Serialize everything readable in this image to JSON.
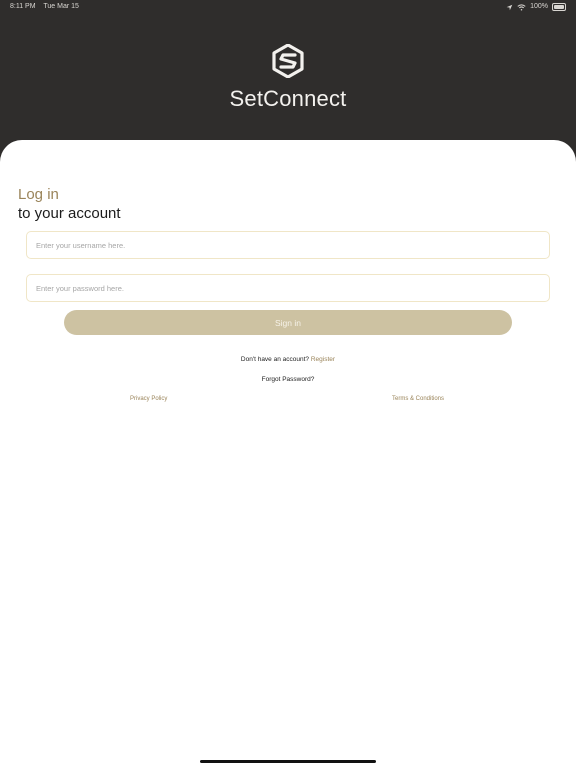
{
  "status_bar": {
    "time": "8:11 PM",
    "date": "Tue Mar 15",
    "battery": "100%"
  },
  "brand": {
    "name": "SetConnect",
    "logo_icon": "setconnect-logo-icon"
  },
  "login": {
    "title_line1": "Log in",
    "title_line2": "to your account",
    "username_placeholder": "Enter your username here.",
    "password_placeholder": "Enter your password here.",
    "sign_in_label": "Sign in"
  },
  "links": {
    "no_account_text": "Don't have an account?",
    "register": "Register",
    "forgot_password": "Forgot Password?",
    "privacy_policy": "Privacy Policy",
    "terms": "Terms & Conditions"
  },
  "colors": {
    "header_bg": "#2f2d2c",
    "accent_gold": "#9a845a",
    "button_bg": "#cdc2a2",
    "field_border": "#f0e6c7"
  }
}
